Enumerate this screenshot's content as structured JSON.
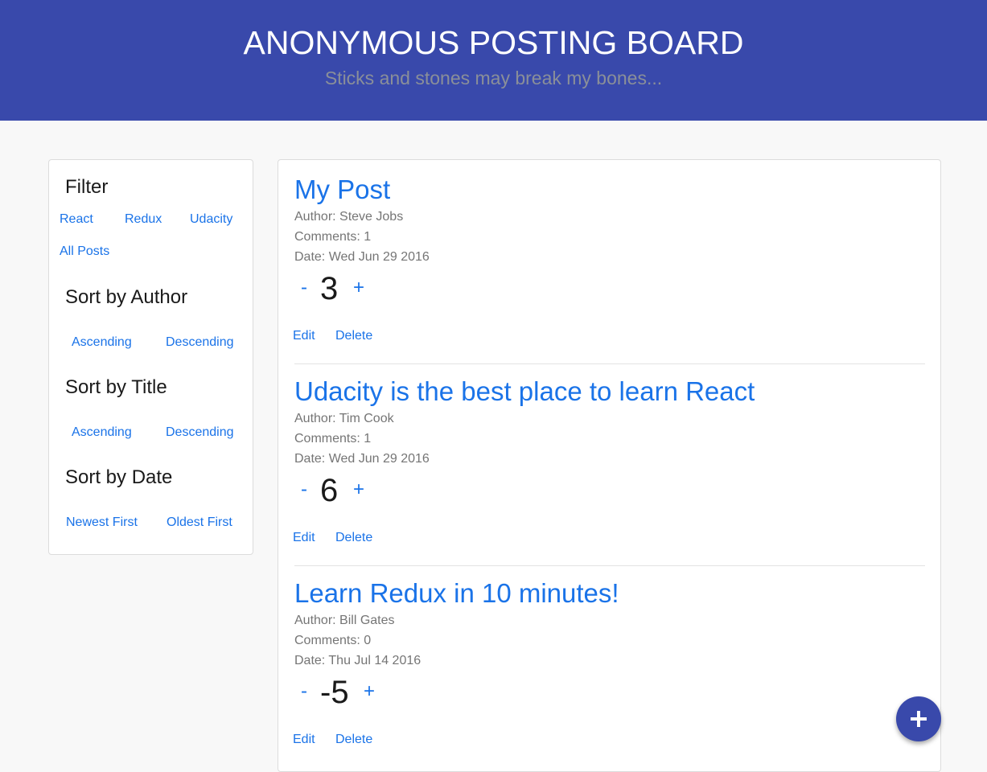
{
  "header": {
    "title": "ANONYMOUS POSTING BOARD",
    "subtitle": "Sticks and stones may break my bones..."
  },
  "sidebar": {
    "filter": {
      "heading": "Filter",
      "options": [
        "React",
        "Redux",
        "Udacity",
        "All Posts"
      ]
    },
    "sort_author": {
      "heading": "Sort by Author",
      "options": [
        "Ascending",
        "Descending"
      ]
    },
    "sort_title": {
      "heading": "Sort by Title",
      "options": [
        "Ascending",
        "Descending"
      ]
    },
    "sort_date": {
      "heading": "Sort by Date",
      "options": [
        "Newest First",
        "Oldest First"
      ]
    }
  },
  "posts": [
    {
      "title": "My Post",
      "author": "Author: Steve Jobs",
      "comments": "Comments: 1",
      "date": "Date: Wed Jun 29 2016",
      "score": "3",
      "minus": "-",
      "plus": "+",
      "edit": "Edit",
      "delete": "Delete"
    },
    {
      "title": "Udacity is the best place to learn React",
      "author": "Author: Tim Cook",
      "comments": "Comments: 1",
      "date": "Date: Wed Jun 29 2016",
      "score": "6",
      "minus": "-",
      "plus": "+",
      "edit": "Edit",
      "delete": "Delete"
    },
    {
      "title": "Learn Redux in 10 minutes!",
      "author": "Author: Bill Gates",
      "comments": "Comments: 0",
      "date": "Date: Thu Jul 14 2016",
      "score": "-5",
      "minus": "-",
      "plus": "+",
      "edit": "Edit",
      "delete": "Delete"
    }
  ],
  "fab": {
    "icon": "plus-icon"
  }
}
